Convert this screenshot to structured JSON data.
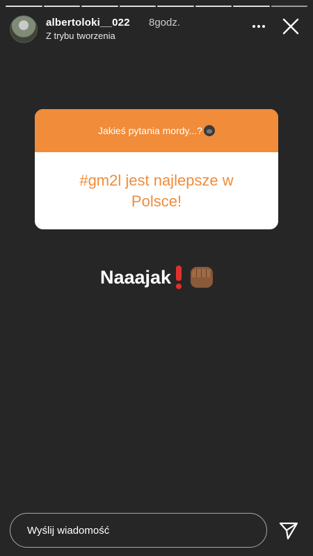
{
  "story": {
    "progress_segments": 8,
    "completed_segments": 7,
    "accent_color": "#f08c3a"
  },
  "header": {
    "username": "albertoloki__022",
    "timestamp": "8godz.",
    "subtitle": "Z trybu tworzenia"
  },
  "question_sticker": {
    "prompt": "Jakieś pytania mordy...?",
    "prompt_emoji": "gorilla-icon",
    "answer": "#gm2l jest najlepsze w Polsce!"
  },
  "caption": {
    "text": "Naaajak",
    "emojis": [
      "exclamation-icon",
      "fist-icon"
    ]
  },
  "reply": {
    "placeholder": "Wyślij wiadomość"
  }
}
